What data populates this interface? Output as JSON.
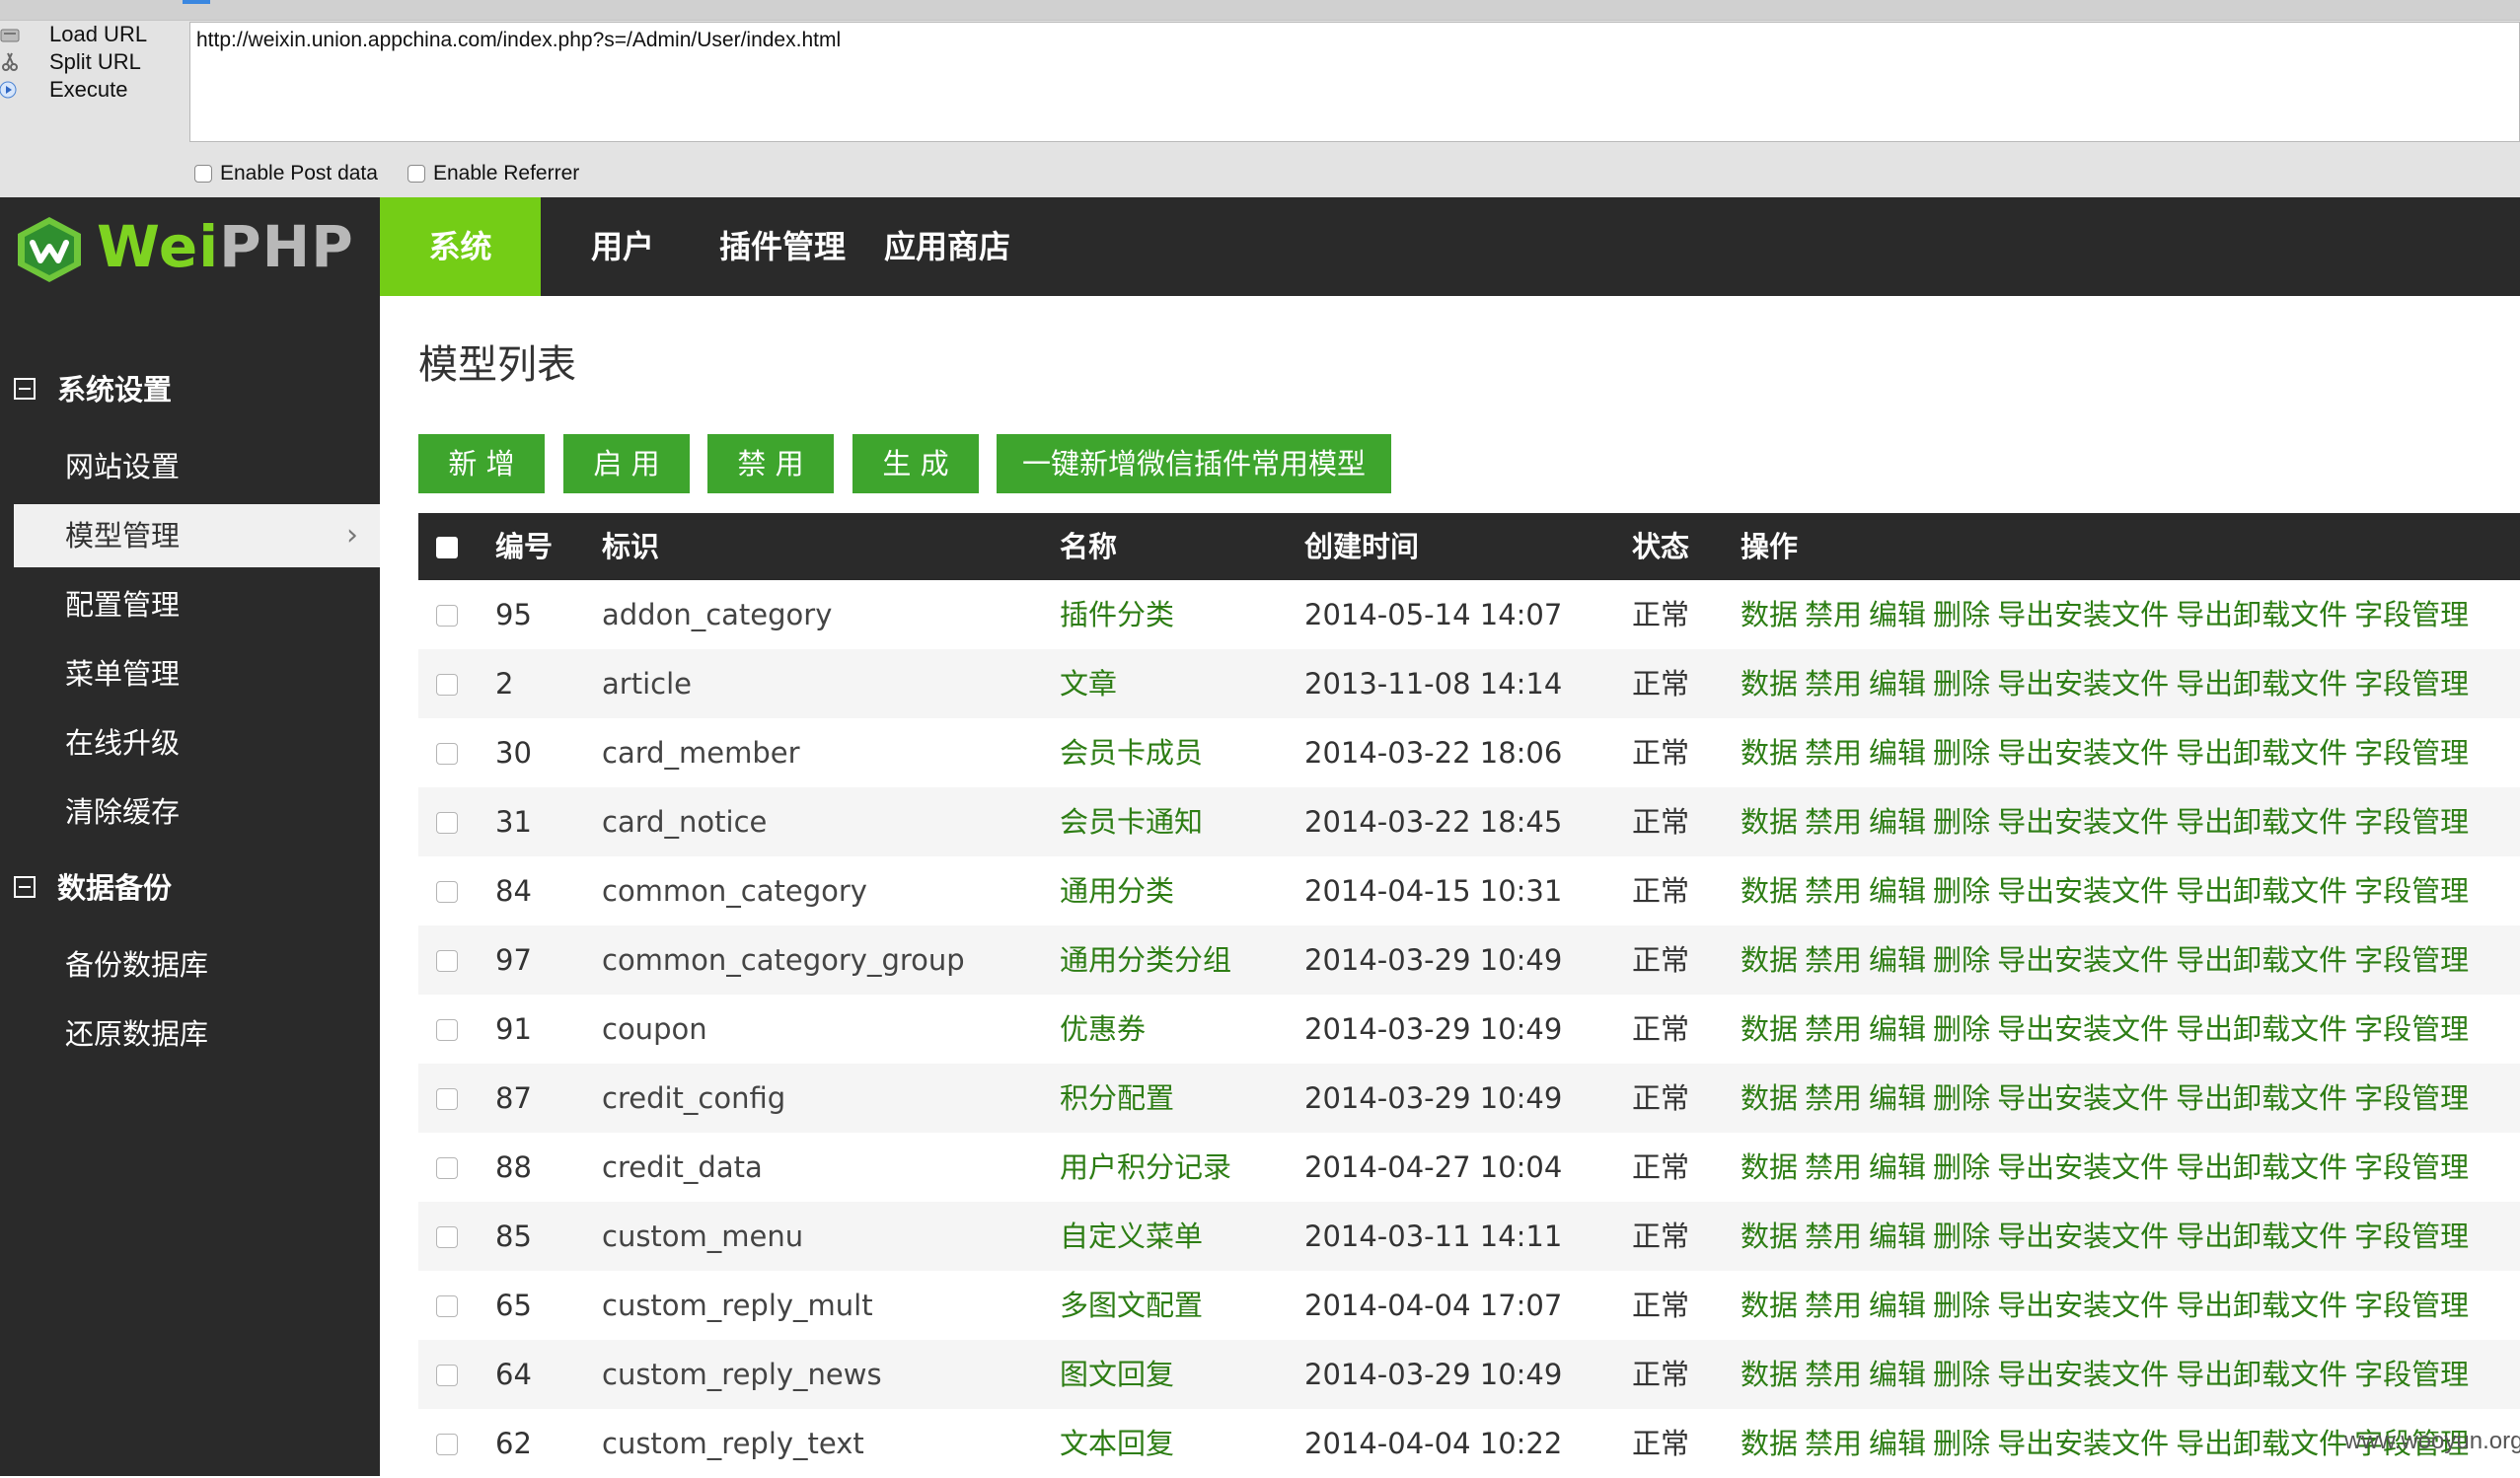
{
  "hackbar": {
    "load_url": "Load URL",
    "split_url": "Split URL",
    "execute": "Execute",
    "url": "http://weixin.union.appchina.com/index.php?s=/Admin/User/index.html",
    "enable_post": "Enable Post data",
    "enable_referrer": "Enable Referrer"
  },
  "logo": {
    "part1": "Wei",
    "part2": "PHP"
  },
  "nav": [
    "系统",
    "用户",
    "插件管理",
    "应用商店"
  ],
  "sidebar": {
    "groups": [
      {
        "label": "系统设置",
        "items": [
          "网站设置",
          "模型管理",
          "配置管理",
          "菜单管理",
          "在线升级",
          "清除缓存"
        ]
      },
      {
        "label": "数据备份",
        "items": [
          "备份数据库",
          "还原数据库"
        ]
      }
    ],
    "active_item": "模型管理"
  },
  "main": {
    "title": "模型列表",
    "buttons": [
      "新 增",
      "启 用",
      "禁 用",
      "生 成",
      "一键新增微信插件常用模型"
    ]
  },
  "table": {
    "headers": [
      "编号",
      "标识",
      "名称",
      "创建时间",
      "状态",
      "操作"
    ],
    "actions": [
      "数据",
      "禁用",
      "编辑",
      "删除",
      "导出安装文件",
      "导出卸载文件",
      "字段管理"
    ],
    "rows": [
      {
        "id": "95",
        "ident": "addon_category",
        "name": "插件分类",
        "created": "2014-05-14 14:07",
        "status": "正常"
      },
      {
        "id": "2",
        "ident": "article",
        "name": "文章",
        "created": "2013-11-08 14:14",
        "status": "正常"
      },
      {
        "id": "30",
        "ident": "card_member",
        "name": "会员卡成员",
        "created": "2014-03-22 18:06",
        "status": "正常"
      },
      {
        "id": "31",
        "ident": "card_notice",
        "name": "会员卡通知",
        "created": "2014-03-22 18:45",
        "status": "正常"
      },
      {
        "id": "84",
        "ident": "common_category",
        "name": "通用分类",
        "created": "2014-04-15 10:31",
        "status": "正常"
      },
      {
        "id": "97",
        "ident": "common_category_group",
        "name": "通用分类分组",
        "created": "2014-03-29 10:49",
        "status": "正常"
      },
      {
        "id": "91",
        "ident": "coupon",
        "name": "优惠券",
        "created": "2014-03-29 10:49",
        "status": "正常"
      },
      {
        "id": "87",
        "ident": "credit_config",
        "name": "积分配置",
        "created": "2014-03-29 10:49",
        "status": "正常"
      },
      {
        "id": "88",
        "ident": "credit_data",
        "name": "用户积分记录",
        "created": "2014-04-27 10:04",
        "status": "正常"
      },
      {
        "id": "85",
        "ident": "custom_menu",
        "name": "自定义菜单",
        "created": "2014-03-11 14:11",
        "status": "正常"
      },
      {
        "id": "65",
        "ident": "custom_reply_mult",
        "name": "多图文配置",
        "created": "2014-04-04 17:07",
        "status": "正常"
      },
      {
        "id": "64",
        "ident": "custom_reply_news",
        "name": "图文回复",
        "created": "2014-03-29 10:49",
        "status": "正常"
      },
      {
        "id": "62",
        "ident": "custom_reply_text",
        "name": "文本回复",
        "created": "2014-04-04 10:22",
        "status": "正常"
      }
    ]
  },
  "watermark": "www.wooyun.org",
  "colors": {
    "accent_green": "#74cd16",
    "button_green": "#3ea52d",
    "link_green": "#2d7d14",
    "dark_bg": "#2a2a2a"
  }
}
